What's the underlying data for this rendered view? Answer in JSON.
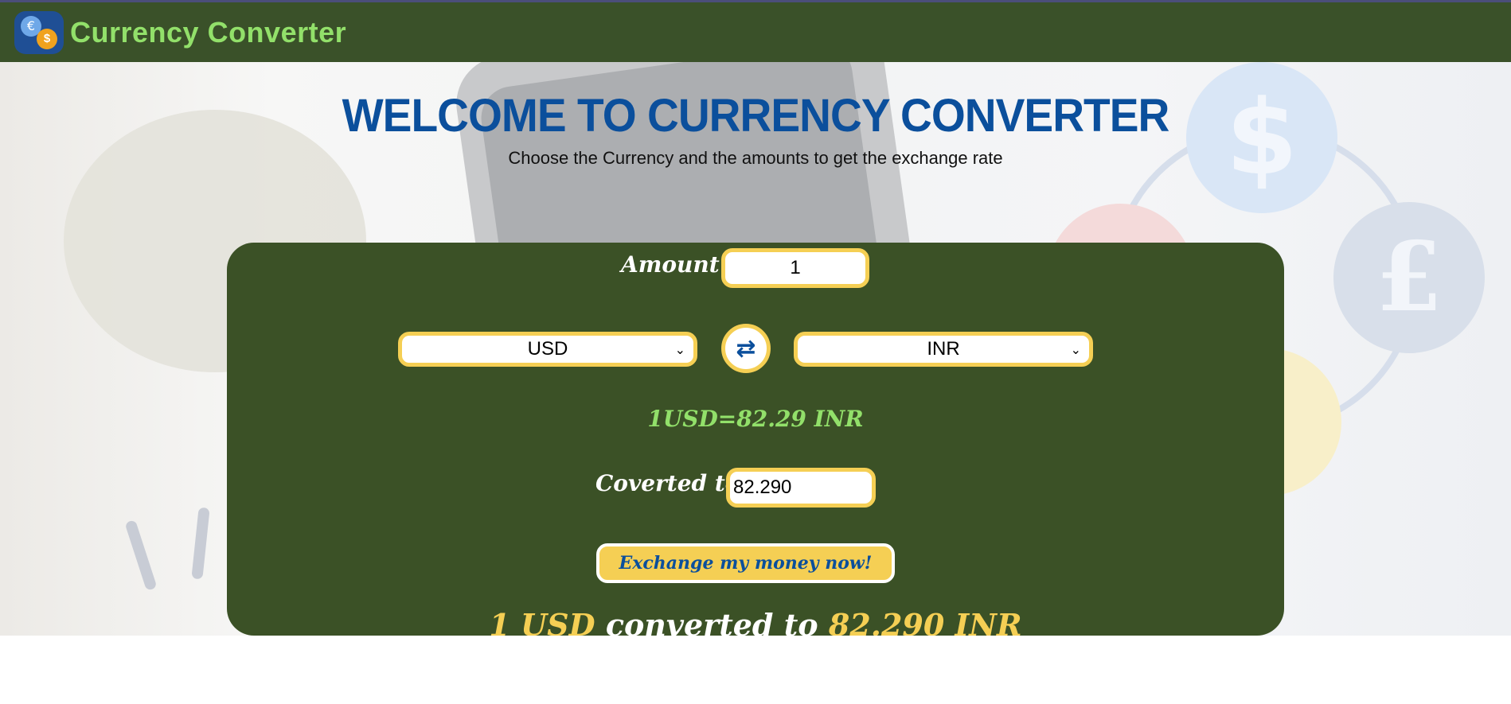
{
  "header": {
    "app_name": "Currency Converter",
    "logo_icon": "currency-exchange-logo"
  },
  "hero": {
    "title": "WELCOME TO CURRENCY CONVERTER",
    "subtitle": "Choose the Currency and the amounts to get the exchange rate"
  },
  "converter": {
    "amount_label": "Amount :",
    "amount_value": "1",
    "from_currency": "USD",
    "to_currency": "INR",
    "swap_icon": "swap-arrows-icon",
    "rate_text": "1USD=82.29 INR",
    "converted_label": "Coverted to :",
    "converted_value": "82.290",
    "action_label": "Exchange my money now!",
    "result": {
      "from": "1 USD",
      "middle": "converted to",
      "to": "82.290 INR"
    }
  },
  "colors": {
    "nav_bg": "#3a5129",
    "panel_bg": "#3b5126",
    "accent_yellow": "#f5cf54",
    "title_blue": "#0b4f9c",
    "brand_green": "#92e06a"
  }
}
